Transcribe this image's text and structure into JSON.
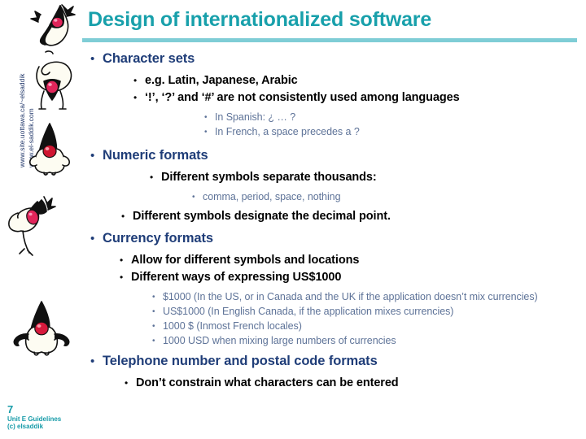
{
  "slide": {
    "title": "Design of internationalized software",
    "accent_color": "#18a0ab",
    "rule_color": "#7fcdd6",
    "level1_color": "#1f3d78",
    "level2_color": "#000000",
    "level3_color": "#5e7398"
  },
  "sidebar": {
    "url_line1": "www.site.uottawa.ca/~elsaddik",
    "url_line2": "www.el-saddik.com",
    "mascot_name": "java-duke-mascot"
  },
  "footer": {
    "page_number": "7",
    "unit_label": "Unit E Guidelines",
    "copyright": "(c) elsaddik"
  },
  "outline": [
    {
      "level": 1,
      "bullet": "•",
      "text": "Character sets"
    },
    {
      "level": 2,
      "bullet": "•",
      "text": "e.g. Latin, Japanese, Arabic"
    },
    {
      "level": 2,
      "bullet": "•",
      "text": "‘!’, ‘?’ and ‘#’ are not consistently used among languages"
    },
    {
      "level": 3,
      "bullet": "•",
      "text": "In Spanish: ¿ … ?"
    },
    {
      "level": 3,
      "bullet": "•",
      "text": "In French, a space precedes a ?"
    },
    {
      "level": 1,
      "bullet": "•",
      "text": "Numeric formats"
    },
    {
      "level": 2,
      "bullet": "•",
      "text": "Different symbols separate thousands:"
    },
    {
      "level": 3,
      "bullet": "•",
      "text": "comma, period, space, nothing"
    },
    {
      "level": 2,
      "bullet": "•",
      "text": "Different symbols designate the decimal point."
    },
    {
      "level": 1,
      "bullet": "•",
      "text": "Currency formats"
    },
    {
      "level": 2,
      "bullet": "•",
      "text": "Allow for different symbols and locations"
    },
    {
      "level": 2,
      "bullet": "•",
      "text": "Different ways of expressing US$1000"
    },
    {
      "level": 3,
      "bullet": "•",
      "text": "$1000 (In the US, or in Canada and the UK if the application doesn’t mix currencies)"
    },
    {
      "level": 3,
      "bullet": "•",
      "text": "US$1000 (In English Canada, if the application mixes currencies)"
    },
    {
      "level": 3,
      "bullet": "•",
      "text": "1000 $  (Inmost French locales)"
    },
    {
      "level": 3,
      "bullet": "•",
      "text": "1000 USD when mixing large numbers of currencies"
    },
    {
      "level": 1,
      "bullet": "•",
      "text": "Telephone number and postal code formats"
    },
    {
      "level": 2,
      "bullet": "•",
      "text": "Don’t constrain what characters can be entered"
    }
  ]
}
